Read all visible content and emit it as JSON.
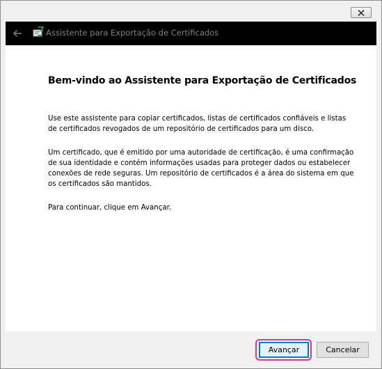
{
  "window": {
    "close_icon": "close-icon"
  },
  "header": {
    "back_icon": "back-arrow-icon",
    "wizard_icon": "certificate-wizard-icon",
    "title": "Assistente para Exportação de Certificados"
  },
  "content": {
    "heading": "Bem-vindo ao Assistente para Exportação de Certificados",
    "paragraphs": [
      "Use este assistente para copiar certificados, listas de certificados confiáveis e listas de certificados revogados de um repositório de certificados para um disco.",
      "Um certificado, que é emitido por uma autoridade de certificação, é uma confirmação de sua identidade e contém informações usadas para proteger dados ou estabelecer conexões de rede seguras. Um repositório de certificados é a área do sistema em que os certificados são mantidos.",
      "Para continuar, clique em Avançar."
    ]
  },
  "footer": {
    "next_label": "Avançar",
    "cancel_label": "Cancelar",
    "highlight_color": "#d9368c"
  }
}
